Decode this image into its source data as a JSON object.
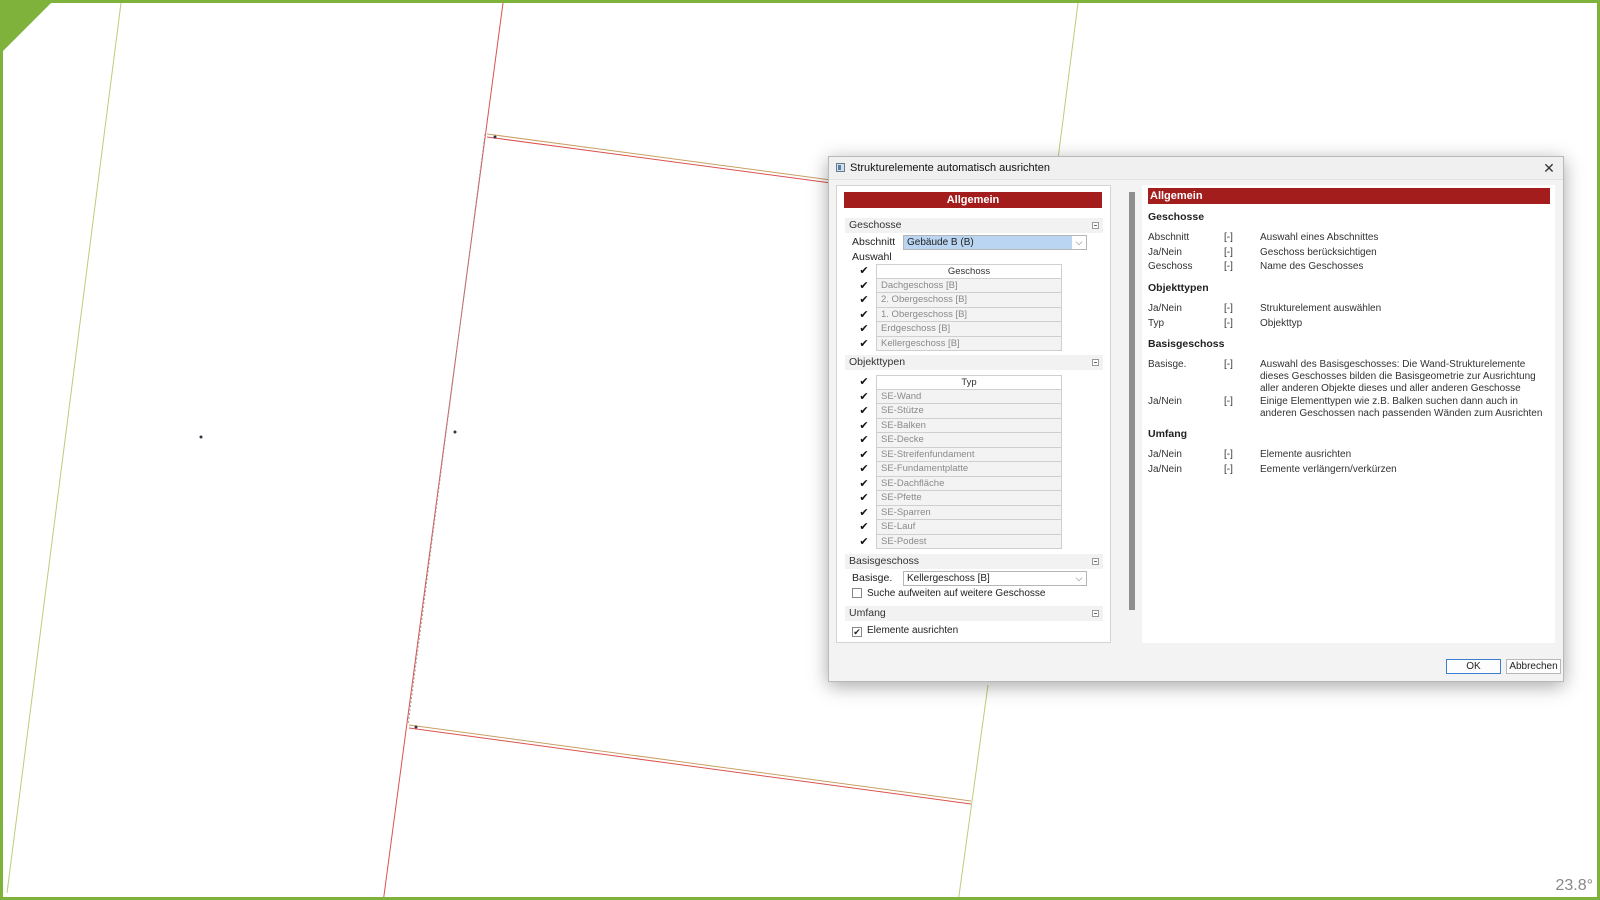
{
  "canvas": {
    "zoom_readout": "23.8°"
  },
  "dialog": {
    "title": "Strukturelemente automatisch ausrichten",
    "close_glyph": "✕",
    "left_panel": {
      "header": "Allgemein",
      "geschosse": {
        "title": "Geschosse",
        "abschnitt_label": "Abschnitt",
        "abschnitt_value": "Gebäude B (B)",
        "auswahl_label": "Auswahl",
        "column_header": "Geschoss",
        "rows": [
          {
            "checked": true,
            "label": "Dachgeschoss [B]"
          },
          {
            "checked": true,
            "label": "2. Obergeschoss [B]"
          },
          {
            "checked": true,
            "label": "1. Obergeschoss [B]"
          },
          {
            "checked": true,
            "label": "Erdgeschoss [B]"
          },
          {
            "checked": true,
            "label": "Kellergeschoss [B]"
          }
        ]
      },
      "objekttypen": {
        "title": "Objekttypen",
        "column_header": "Typ",
        "rows": [
          {
            "checked": true,
            "label": "SE-Wand"
          },
          {
            "checked": true,
            "label": "SE-Stütze"
          },
          {
            "checked": true,
            "label": "SE-Balken"
          },
          {
            "checked": true,
            "label": "SE-Decke"
          },
          {
            "checked": true,
            "label": "SE-Streifenfundament"
          },
          {
            "checked": true,
            "label": "SE-Fundamentplatte"
          },
          {
            "checked": true,
            "label": "SE-Dachfläche"
          },
          {
            "checked": true,
            "label": "SE-Pfette"
          },
          {
            "checked": true,
            "label": "SE-Sparren"
          },
          {
            "checked": true,
            "label": "SE-Lauf"
          },
          {
            "checked": true,
            "label": "SE-Podest"
          }
        ]
      },
      "basisgeschoss": {
        "title": "Basisgeschoss",
        "label": "Basisge.",
        "value": "Kellergeschoss [B]",
        "extend_search_label": "Suche aufweiten auf weitere Geschosse",
        "extend_search_checked": false
      },
      "umfang": {
        "title": "Umfang",
        "align_label": "Elemente ausrichten",
        "align_checked": true
      }
    },
    "right_panel": {
      "header": "Allgemein",
      "sections": [
        {
          "heading": "Geschosse",
          "rows": [
            {
              "key": "Abschnitt",
              "unit": "[-]",
              "desc": "Auswahl eines Abschnittes"
            },
            {
              "key": "Ja/Nein",
              "unit": "[-]",
              "desc": "Geschoss berücksichtigen"
            },
            {
              "key": "Geschoss",
              "unit": "[-]",
              "desc": "Name des Geschosses"
            }
          ]
        },
        {
          "heading": "Objekttypen",
          "rows": [
            {
              "key": "Ja/Nein",
              "unit": "[-]",
              "desc": "Strukturelement auswählen"
            },
            {
              "key": "Typ",
              "unit": "[-]",
              "desc": "Objekttyp"
            }
          ]
        },
        {
          "heading": "Basisgeschoss",
          "rows": [
            {
              "key": "Basisge.",
              "unit": "[-]",
              "desc": "Auswahl des Basisgeschosses: Die Wand-Strukturelemente dieses Geschosses bilden die Basisgeometrie zur Ausrichtung aller anderen Objekte dieses und aller anderen Geschosse"
            },
            {
              "key": "Ja/Nein",
              "unit": "[-]",
              "desc": "Einige Elementtypen wie z.B. Balken suchen dann auch in anderen Geschossen nach passenden Wänden zum Ausrichten"
            }
          ]
        },
        {
          "heading": "Umfang",
          "rows": [
            {
              "key": "Ja/Nein",
              "unit": "[-]",
              "desc": "Elemente ausrichten"
            },
            {
              "key": "Ja/Nein",
              "unit": "[-]",
              "desc": "Eemente verlängern/verkürzen"
            }
          ]
        }
      ]
    },
    "buttons": {
      "ok": "OK",
      "cancel": "Abbrechen"
    }
  },
  "colors": {
    "viewport_border": "#7fb23a",
    "header_red": "#a31d1d",
    "line_red": "#d9534f",
    "line_green": "#a8c060"
  }
}
